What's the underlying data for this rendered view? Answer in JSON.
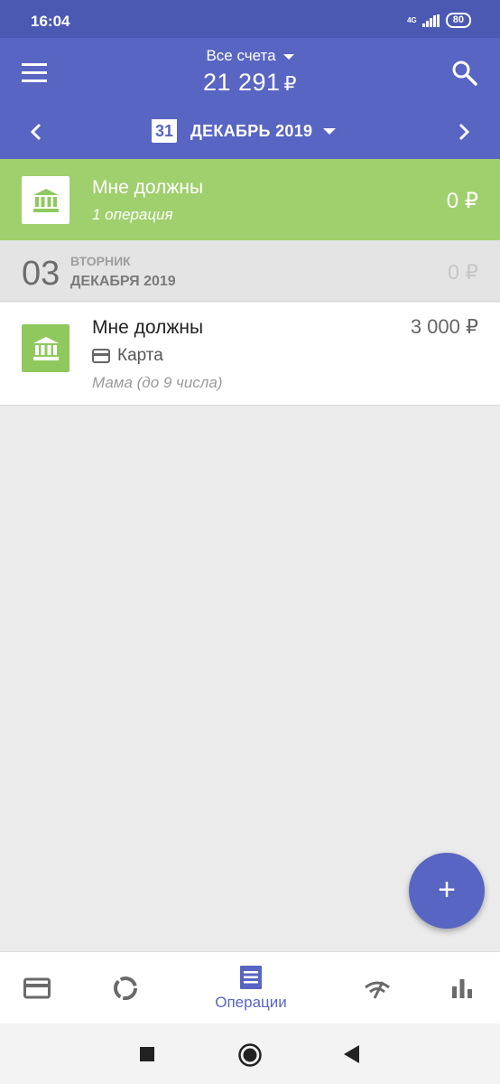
{
  "status_bar": {
    "time": "16:04",
    "network": "4G",
    "battery": "80"
  },
  "header": {
    "account_name": "Все счета",
    "balance": "21 291",
    "currency": "₽",
    "period_day": "31",
    "period_label": "ДЕКАБРЬ 2019"
  },
  "summary": {
    "title": "Мне должны",
    "subtitle": "1 операция",
    "amount": "0 ₽"
  },
  "date_group": {
    "day": "03",
    "weekday": "ВТОРНИК",
    "month": "ДЕКАБРЯ 2019",
    "amount": "0 ₽"
  },
  "transaction": {
    "title": "Мне должны",
    "account": "Карта",
    "note": "Мама (до 9 числа)",
    "amount": "3 000 ₽"
  },
  "fab": {
    "label": "+"
  },
  "bottom_nav": {
    "items": [
      {
        "icon": "card-icon",
        "label": ""
      },
      {
        "icon": "ring-chart-icon",
        "label": ""
      },
      {
        "icon": "operations-icon",
        "label": "Операции"
      },
      {
        "icon": "signal-icon",
        "label": ""
      },
      {
        "icon": "bar-chart-icon",
        "label": ""
      }
    ]
  },
  "colors": {
    "primary": "#5865c2",
    "status_bar": "#4b59b3",
    "green": "#9fd06d",
    "green_icon": "#8fc95e"
  }
}
